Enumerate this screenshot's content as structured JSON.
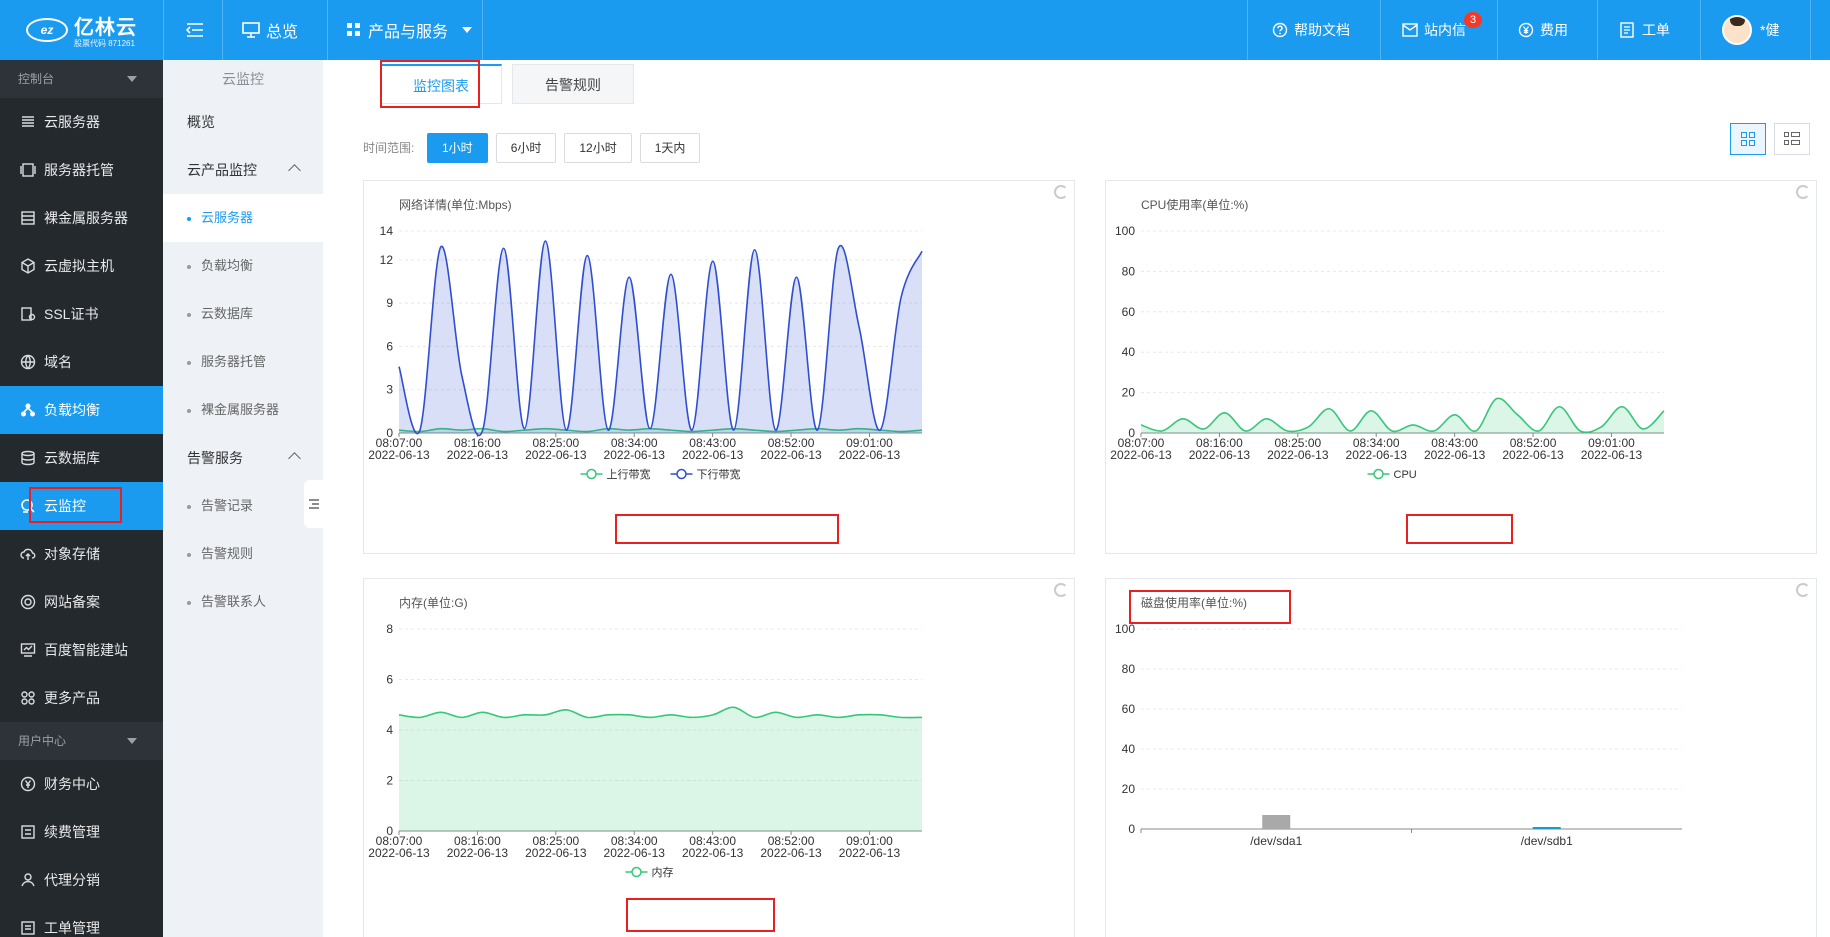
{
  "brand": {
    "logo_mark": "ez",
    "name": "亿林云",
    "sub": "股票代码 871261"
  },
  "topbar": {
    "menu_icon": "menu-fold-icon",
    "overview": "总览",
    "products": "产品与服务",
    "help": "帮助文档",
    "messages": "站内信",
    "messages_count": "3",
    "fees": "费用",
    "tickets": "工单",
    "user": "*健"
  },
  "sidebar": {
    "section_console": "控制台",
    "items": [
      {
        "label": "云服务器",
        "icon": "server-icon"
      },
      {
        "label": "服务器托管",
        "icon": "rack-icon"
      },
      {
        "label": "裸金属服务器",
        "icon": "baremetal-icon"
      },
      {
        "label": "云虚拟主机",
        "icon": "cube-icon"
      },
      {
        "label": "SSL证书",
        "icon": "certificate-icon"
      },
      {
        "label": "域名",
        "icon": "globe-icon"
      },
      {
        "label": "负载均衡",
        "icon": "balance-icon"
      },
      {
        "label": "云数据库",
        "icon": "database-icon"
      },
      {
        "label": "云监控",
        "icon": "monitor-icon"
      },
      {
        "label": "对象存储",
        "icon": "cloud-upload-icon"
      },
      {
        "label": "网站备案",
        "icon": "record-icon"
      },
      {
        "label": "百度智能建站",
        "icon": "site-icon"
      },
      {
        "label": "更多产品",
        "icon": "grid-icon"
      }
    ],
    "section_user": "用户中心",
    "user_items": [
      {
        "label": "财务中心",
        "icon": "finance-icon"
      },
      {
        "label": "续费管理",
        "icon": "renew-icon"
      },
      {
        "label": "代理分销",
        "icon": "agent-icon"
      },
      {
        "label": "工单管理",
        "icon": "ticket-icon"
      }
    ]
  },
  "subnav": {
    "title": "云监控",
    "overview": "概览",
    "group1": "云产品监控",
    "group1_items": [
      "云服务器",
      "负载均衡",
      "云数据库",
      "服务器托管",
      "裸金属服务器"
    ],
    "group2": "告警服务",
    "group2_items": [
      "告警记录",
      "告警规则",
      "告警联系人"
    ]
  },
  "tabs": [
    "监控图表",
    "告警规则"
  ],
  "range": {
    "label": "时间范围:",
    "options": [
      "1小时",
      "6小时",
      "12小时",
      "1天内"
    ],
    "selected": "1小时"
  },
  "colors": {
    "primary": "#1a9bf0",
    "sidebar_bg": "#24292e",
    "green": "#36c77a",
    "blue": "#2f4fd0",
    "annot_red": "#e8201f"
  },
  "chart_data": [
    {
      "type": "area",
      "title": "网络详情(单位:Mbps)",
      "x_ticks": [
        "08:07:00",
        "08:16:00",
        "08:25:00",
        "08:34:00",
        "08:43:00",
        "08:52:00",
        "09:01:00"
      ],
      "x_ticks_date": "2022-06-13",
      "yticks": [
        0,
        3,
        6,
        9,
        12,
        14
      ],
      "ylim": [
        0,
        14
      ],
      "series": [
        {
          "name": "上行带宽",
          "color": "#36c77a",
          "values": [
            0.2,
            0.1,
            0.3,
            0.2,
            0.3,
            0.1,
            0.2,
            0.3,
            0.2,
            0.1,
            0.3,
            0.2,
            0.3,
            0.2,
            0.1,
            0.2,
            0.3,
            0.2,
            0.1,
            0.2,
            0.3,
            0.2,
            0.3,
            0.2,
            0.1,
            0.2
          ]
        },
        {
          "name": "下行带宽",
          "color": "#2f4fd0",
          "values": [
            4.6,
            0.2,
            12.9,
            4.0,
            0.2,
            12.8,
            0.3,
            13.3,
            0.2,
            12.3,
            0.2,
            10.8,
            0.3,
            11.0,
            0.2,
            11.9,
            0.2,
            12.7,
            0.2,
            10.8,
            0.2,
            12.8,
            7.3,
            0.2,
            9.4,
            12.6
          ]
        }
      ]
    },
    {
      "type": "area",
      "title": "CPU使用率(单位:%)",
      "x_ticks": [
        "08:07:00",
        "08:16:00",
        "08:25:00",
        "08:34:00",
        "08:43:00",
        "08:52:00",
        "09:01:00"
      ],
      "x_ticks_date": "2022-06-13",
      "yticks": [
        0,
        20,
        40,
        60,
        80,
        100
      ],
      "ylim": [
        0,
        100
      ],
      "series": [
        {
          "name": "CPU",
          "color": "#36c77a",
          "values": [
            4,
            1,
            7,
            2,
            10,
            1,
            7,
            1,
            3,
            12,
            1,
            11,
            1,
            4,
            1,
            9,
            1,
            17,
            9,
            1,
            13,
            1,
            3,
            13,
            2,
            11
          ]
        }
      ]
    },
    {
      "type": "area",
      "title": "内存(单位:G)",
      "x_ticks": [
        "08:07:00",
        "08:16:00",
        "08:25:00",
        "08:34:00",
        "08:43:00",
        "08:52:00",
        "09:01:00"
      ],
      "x_ticks_date": "2022-06-13",
      "yticks": [
        0,
        2,
        4,
        6,
        8
      ],
      "ylim": [
        0,
        8
      ],
      "series": [
        {
          "name": "内存",
          "color": "#36c77a",
          "values": [
            4.6,
            4.5,
            4.7,
            4.5,
            4.7,
            4.5,
            4.6,
            4.6,
            4.8,
            4.5,
            4.6,
            4.6,
            4.5,
            4.6,
            4.5,
            4.6,
            4.9,
            4.5,
            4.7,
            4.5,
            4.6,
            4.5,
            4.6,
            4.6,
            4.5,
            4.5
          ]
        }
      ]
    },
    {
      "type": "bar",
      "title": "磁盘使用率(单位:%)",
      "categories": [
        "/dev/sda1",
        "/dev/sdb1"
      ],
      "values": [
        7,
        1
      ],
      "bar_colors": [
        "#a9a9a9",
        "#1a9bc8"
      ],
      "yticks": [
        0,
        20,
        40,
        60,
        80,
        100
      ],
      "ylim": [
        0,
        100
      ]
    }
  ]
}
